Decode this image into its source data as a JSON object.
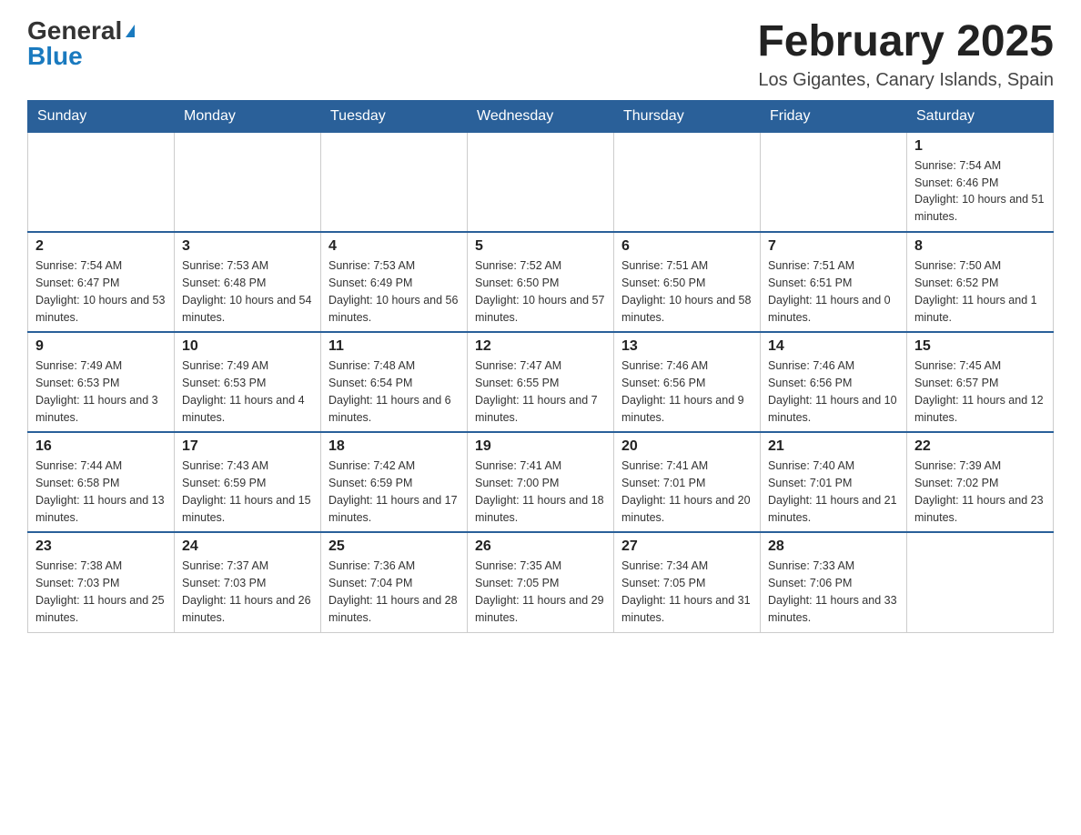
{
  "header": {
    "logo_general": "General",
    "logo_blue": "Blue",
    "month_title": "February 2025",
    "location": "Los Gigantes, Canary Islands, Spain"
  },
  "weekdays": [
    "Sunday",
    "Monday",
    "Tuesday",
    "Wednesday",
    "Thursday",
    "Friday",
    "Saturday"
  ],
  "weeks": [
    [
      {
        "day": "",
        "sunrise": "",
        "sunset": "",
        "daylight": ""
      },
      {
        "day": "",
        "sunrise": "",
        "sunset": "",
        "daylight": ""
      },
      {
        "day": "",
        "sunrise": "",
        "sunset": "",
        "daylight": ""
      },
      {
        "day": "",
        "sunrise": "",
        "sunset": "",
        "daylight": ""
      },
      {
        "day": "",
        "sunrise": "",
        "sunset": "",
        "daylight": ""
      },
      {
        "day": "",
        "sunrise": "",
        "sunset": "",
        "daylight": ""
      },
      {
        "day": "1",
        "sunrise": "Sunrise: 7:54 AM",
        "sunset": "Sunset: 6:46 PM",
        "daylight": "Daylight: 10 hours and 51 minutes."
      }
    ],
    [
      {
        "day": "2",
        "sunrise": "Sunrise: 7:54 AM",
        "sunset": "Sunset: 6:47 PM",
        "daylight": "Daylight: 10 hours and 53 minutes."
      },
      {
        "day": "3",
        "sunrise": "Sunrise: 7:53 AM",
        "sunset": "Sunset: 6:48 PM",
        "daylight": "Daylight: 10 hours and 54 minutes."
      },
      {
        "day": "4",
        "sunrise": "Sunrise: 7:53 AM",
        "sunset": "Sunset: 6:49 PM",
        "daylight": "Daylight: 10 hours and 56 minutes."
      },
      {
        "day": "5",
        "sunrise": "Sunrise: 7:52 AM",
        "sunset": "Sunset: 6:50 PM",
        "daylight": "Daylight: 10 hours and 57 minutes."
      },
      {
        "day": "6",
        "sunrise": "Sunrise: 7:51 AM",
        "sunset": "Sunset: 6:50 PM",
        "daylight": "Daylight: 10 hours and 58 minutes."
      },
      {
        "day": "7",
        "sunrise": "Sunrise: 7:51 AM",
        "sunset": "Sunset: 6:51 PM",
        "daylight": "Daylight: 11 hours and 0 minutes."
      },
      {
        "day": "8",
        "sunrise": "Sunrise: 7:50 AM",
        "sunset": "Sunset: 6:52 PM",
        "daylight": "Daylight: 11 hours and 1 minute."
      }
    ],
    [
      {
        "day": "9",
        "sunrise": "Sunrise: 7:49 AM",
        "sunset": "Sunset: 6:53 PM",
        "daylight": "Daylight: 11 hours and 3 minutes."
      },
      {
        "day": "10",
        "sunrise": "Sunrise: 7:49 AM",
        "sunset": "Sunset: 6:53 PM",
        "daylight": "Daylight: 11 hours and 4 minutes."
      },
      {
        "day": "11",
        "sunrise": "Sunrise: 7:48 AM",
        "sunset": "Sunset: 6:54 PM",
        "daylight": "Daylight: 11 hours and 6 minutes."
      },
      {
        "day": "12",
        "sunrise": "Sunrise: 7:47 AM",
        "sunset": "Sunset: 6:55 PM",
        "daylight": "Daylight: 11 hours and 7 minutes."
      },
      {
        "day": "13",
        "sunrise": "Sunrise: 7:46 AM",
        "sunset": "Sunset: 6:56 PM",
        "daylight": "Daylight: 11 hours and 9 minutes."
      },
      {
        "day": "14",
        "sunrise": "Sunrise: 7:46 AM",
        "sunset": "Sunset: 6:56 PM",
        "daylight": "Daylight: 11 hours and 10 minutes."
      },
      {
        "day": "15",
        "sunrise": "Sunrise: 7:45 AM",
        "sunset": "Sunset: 6:57 PM",
        "daylight": "Daylight: 11 hours and 12 minutes."
      }
    ],
    [
      {
        "day": "16",
        "sunrise": "Sunrise: 7:44 AM",
        "sunset": "Sunset: 6:58 PM",
        "daylight": "Daylight: 11 hours and 13 minutes."
      },
      {
        "day": "17",
        "sunrise": "Sunrise: 7:43 AM",
        "sunset": "Sunset: 6:59 PM",
        "daylight": "Daylight: 11 hours and 15 minutes."
      },
      {
        "day": "18",
        "sunrise": "Sunrise: 7:42 AM",
        "sunset": "Sunset: 6:59 PM",
        "daylight": "Daylight: 11 hours and 17 minutes."
      },
      {
        "day": "19",
        "sunrise": "Sunrise: 7:41 AM",
        "sunset": "Sunset: 7:00 PM",
        "daylight": "Daylight: 11 hours and 18 minutes."
      },
      {
        "day": "20",
        "sunrise": "Sunrise: 7:41 AM",
        "sunset": "Sunset: 7:01 PM",
        "daylight": "Daylight: 11 hours and 20 minutes."
      },
      {
        "day": "21",
        "sunrise": "Sunrise: 7:40 AM",
        "sunset": "Sunset: 7:01 PM",
        "daylight": "Daylight: 11 hours and 21 minutes."
      },
      {
        "day": "22",
        "sunrise": "Sunrise: 7:39 AM",
        "sunset": "Sunset: 7:02 PM",
        "daylight": "Daylight: 11 hours and 23 minutes."
      }
    ],
    [
      {
        "day": "23",
        "sunrise": "Sunrise: 7:38 AM",
        "sunset": "Sunset: 7:03 PM",
        "daylight": "Daylight: 11 hours and 25 minutes."
      },
      {
        "day": "24",
        "sunrise": "Sunrise: 7:37 AM",
        "sunset": "Sunset: 7:03 PM",
        "daylight": "Daylight: 11 hours and 26 minutes."
      },
      {
        "day": "25",
        "sunrise": "Sunrise: 7:36 AM",
        "sunset": "Sunset: 7:04 PM",
        "daylight": "Daylight: 11 hours and 28 minutes."
      },
      {
        "day": "26",
        "sunrise": "Sunrise: 7:35 AM",
        "sunset": "Sunset: 7:05 PM",
        "daylight": "Daylight: 11 hours and 29 minutes."
      },
      {
        "day": "27",
        "sunrise": "Sunrise: 7:34 AM",
        "sunset": "Sunset: 7:05 PM",
        "daylight": "Daylight: 11 hours and 31 minutes."
      },
      {
        "day": "28",
        "sunrise": "Sunrise: 7:33 AM",
        "sunset": "Sunset: 7:06 PM",
        "daylight": "Daylight: 11 hours and 33 minutes."
      },
      {
        "day": "",
        "sunrise": "",
        "sunset": "",
        "daylight": ""
      }
    ]
  ]
}
